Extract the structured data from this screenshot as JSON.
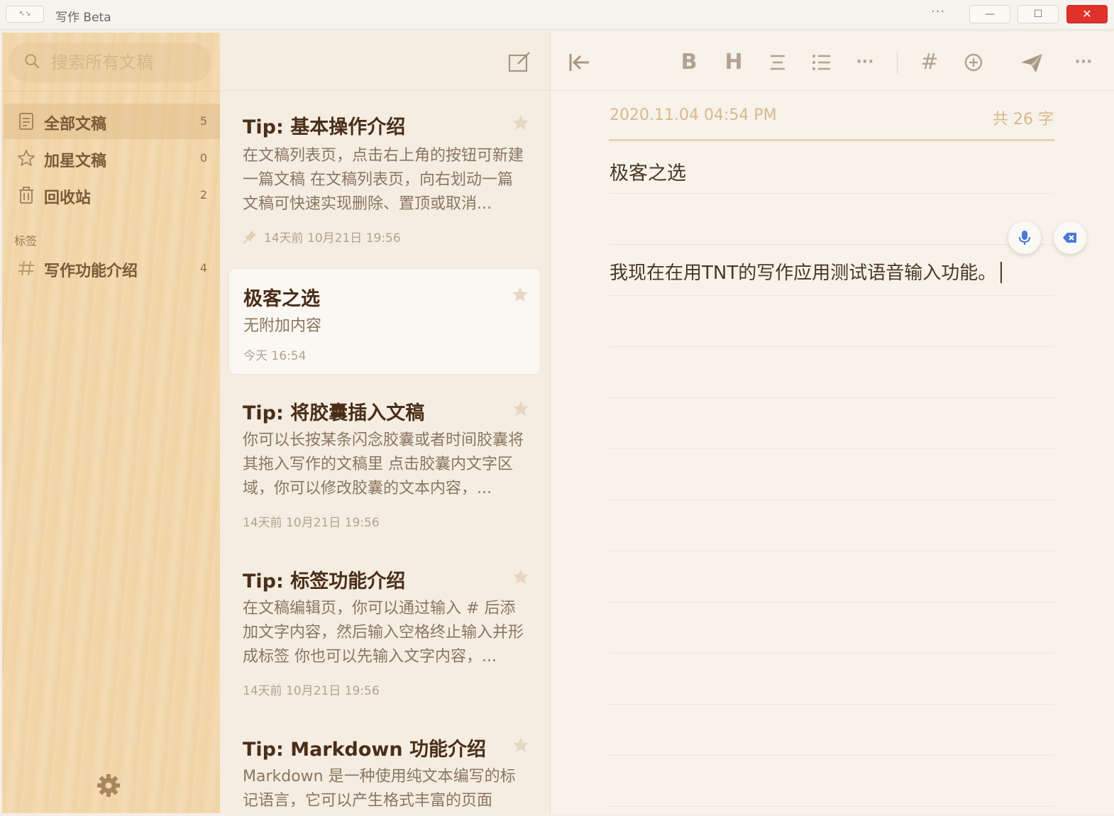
{
  "window": {
    "icon_label": "↖↘",
    "title": "写作 Beta",
    "more": "···",
    "minimize": "—",
    "maximize": "☐",
    "close": "✕"
  },
  "sidebar": {
    "search_placeholder": "搜索所有文稿",
    "nav": [
      {
        "label": "全部文稿",
        "count": "5"
      },
      {
        "label": "加星文稿",
        "count": "0"
      },
      {
        "label": "回收站",
        "count": "2"
      }
    ],
    "tags_header": "标签",
    "tags": [
      {
        "label": "写作功能介绍",
        "count": "4"
      }
    ]
  },
  "doclist": {
    "cards": [
      {
        "title": "Tip: 基本操作介绍",
        "excerpt": "在文稿列表页，点击右上角的按钮可新建一篇文稿 在文稿列表页，向右划动一篇文稿可快速实现删除、置顶或取消...",
        "meta": "14天前  10月21日 19:56"
      },
      {
        "title": "极客之选",
        "excerpt": "无附加内容",
        "meta": "今天 16:54"
      },
      {
        "title": "Tip: 将胶囊插入文稿",
        "excerpt": "你可以长按某条闪念胶囊或者时间胶囊将其拖入写作的文稿里 点击胶囊内文字区域，你可以修改胶囊的文本内容，...",
        "meta": "14天前  10月21日 19:56"
      },
      {
        "title": "Tip: 标签功能介绍",
        "excerpt": "在文稿编辑页，你可以通过输入 # 后添加文字内容，然后输入空格终止输入并形成标签 你也可以先输入文字内容，...",
        "meta": "14天前  10月21日 19:56"
      },
      {
        "title": "Tip: Markdown 功能介绍",
        "excerpt": "Markdown 是一种使用纯文本编写的标记语言，它可以产生格式丰富的页面",
        "meta": ""
      }
    ]
  },
  "editor": {
    "toolbar": {
      "bold": "B",
      "heading": "H",
      "more": "···",
      "tag": "#",
      "overflow": "···"
    },
    "date": "2020.11.04  04:54 PM",
    "word_count": "共 26 字",
    "title": "极客之选",
    "body": "我现在在用TNT的写作应用测试语音输入功能。"
  },
  "colors": {
    "accent": "#d8b98b",
    "sidebar_wood": "#f3d8ad",
    "close_red": "#e0322a",
    "voice_blue": "#4a78d4"
  }
}
